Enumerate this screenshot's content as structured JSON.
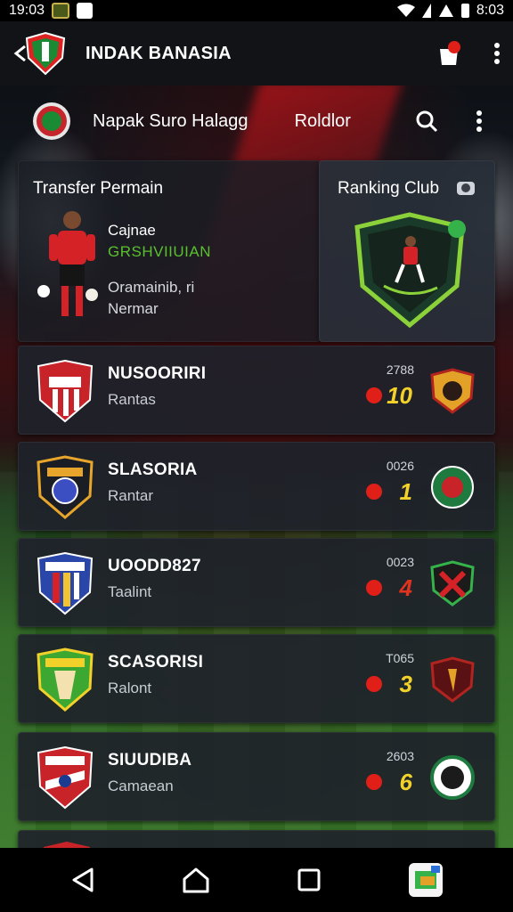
{
  "status_bar": {
    "time_left": "19:03",
    "time_right": "8:03"
  },
  "app_bar": {
    "title": "INDAK BANASIA"
  },
  "sub_header": {
    "club_name": "Napak Suro Halagg",
    "tab_label": "Roldlor"
  },
  "transfer": {
    "heading": "Transfer Permain",
    "player_name": "Cajnae",
    "player_club": "GRSHVIIUIAN",
    "detail_line1": "Oramainib, ri",
    "detail_line2": "Nermar"
  },
  "ranking": {
    "heading": "Ranking Club"
  },
  "teams": [
    {
      "name": "NUSOORIRI",
      "sub": "Rantas",
      "code": "2788",
      "rank": "10"
    },
    {
      "name": "SLASORIA",
      "sub": "Rantar",
      "code": "0026",
      "rank": "1"
    },
    {
      "name": "UOODD827",
      "sub": "Taalint",
      "code": "0023",
      "rank": "4"
    },
    {
      "name": "SCASORISI",
      "sub": "Ralont",
      "code": "T065",
      "rank": "3"
    },
    {
      "name": "SIUUDIBA",
      "sub": "Camaean",
      "code": "2603",
      "rank": "6"
    }
  ],
  "colors": {
    "accent": "#f2d12a",
    "status_dot": "#e02018",
    "green": "#59c12d"
  },
  "icons": [
    "wifi-icon",
    "signal-icon",
    "battery-icon",
    "notification-icon",
    "more-icon",
    "search-icon",
    "camera-icon",
    "back-icon",
    "home-icon",
    "recents-icon",
    "app-icon"
  ]
}
